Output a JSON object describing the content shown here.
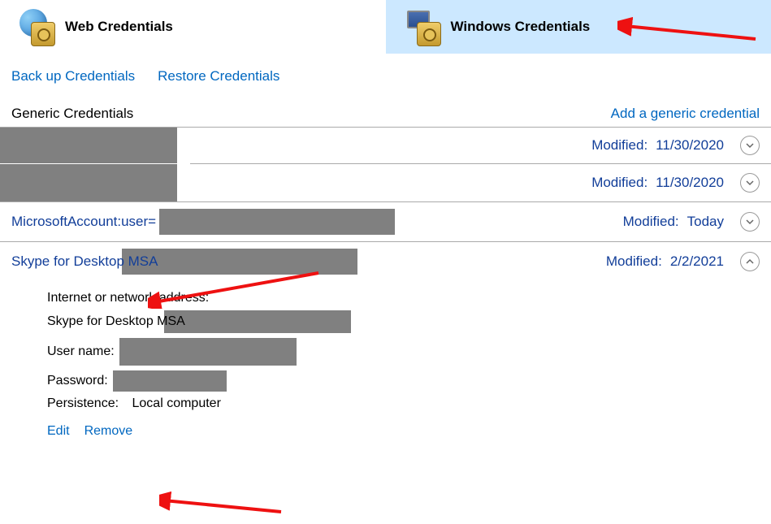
{
  "tabs": {
    "web": "Web Credentials",
    "windows": "Windows Credentials"
  },
  "links": {
    "backup": "Back up Credentials",
    "restore": "Restore Credentials"
  },
  "section": {
    "title": "Generic Credentials",
    "add": "Add a generic credential"
  },
  "rows": [
    {
      "modified_label": "Modified:",
      "modified_value": "11/30/2020"
    },
    {
      "modified_label": "Modified:",
      "modified_value": "11/30/2020"
    },
    {
      "name_prefix": "MicrosoftAccount:user=",
      "modified_label": "Modified:",
      "modified_value": "Today"
    },
    {
      "name_prefix": "Skype for Desktop MSA",
      "modified_label": "Modified:",
      "modified_value": "2/2/2021"
    }
  ],
  "details": {
    "addr_label": "Internet or network address:",
    "addr_prefix": "Skype for Desktop MSA",
    "user_label": "User name:",
    "pwd_label": "Password:",
    "persist_label": "Persistence:",
    "persist_value": "Local computer",
    "edit": "Edit",
    "remove": "Remove"
  }
}
